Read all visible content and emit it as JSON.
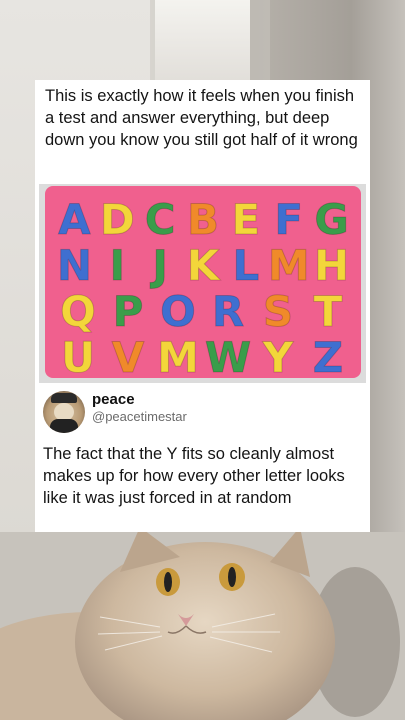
{
  "post": {
    "caption": "This is exactly how it feels when you finish a test and answer everything, but deep down you know you still got half of it wrong"
  },
  "puzzle": {
    "board_color": "#f0608e",
    "rows": [
      [
        {
          "ch": "A",
          "c": "#3f6fd0"
        },
        {
          "ch": "D",
          "c": "#f3d63a"
        },
        {
          "ch": "C",
          "c": "#3a9d4a"
        },
        {
          "ch": "B",
          "c": "#f08a2a"
        },
        {
          "ch": "E",
          "c": "#f3d63a"
        },
        {
          "ch": "F",
          "c": "#3f6fd0"
        },
        {
          "ch": "G",
          "c": "#3a9d4a"
        }
      ],
      [
        {
          "ch": "N",
          "c": "#3f6fd0"
        },
        {
          "ch": "I",
          "c": "#3a9d4a"
        },
        {
          "ch": "J",
          "c": "#3a9d4a"
        },
        {
          "ch": "K",
          "c": "#f3d63a"
        },
        {
          "ch": "L",
          "c": "#3f6fd0"
        },
        {
          "ch": "M",
          "c": "#f08a2a"
        },
        {
          "ch": "H",
          "c": "#f3d63a"
        }
      ],
      [
        {
          "ch": "Q",
          "c": "#f3d63a"
        },
        {
          "ch": "P",
          "c": "#3a9d4a"
        },
        {
          "ch": "O",
          "c": "#3f6fd0"
        },
        {
          "ch": "R",
          "c": "#3f6fd0"
        },
        {
          "ch": "S",
          "c": "#f08a2a"
        },
        {
          "ch": "T",
          "c": "#f3d63a"
        }
      ],
      [
        {
          "ch": "U",
          "c": "#f3d63a"
        },
        {
          "ch": "V",
          "c": "#f08a2a"
        },
        {
          "ch": "M",
          "c": "#f3d63a"
        },
        {
          "ch": "W",
          "c": "#3a9d4a"
        },
        {
          "ch": "Y",
          "c": "#f3d63a"
        },
        {
          "ch": "Z",
          "c": "#3f6fd0"
        }
      ]
    ]
  },
  "tweet": {
    "name": "peace",
    "handle": "@peacetimestar",
    "text": "The fact that the Y fits so cleanly almost makes up for how every other letter looks like it was just forced in at random"
  }
}
